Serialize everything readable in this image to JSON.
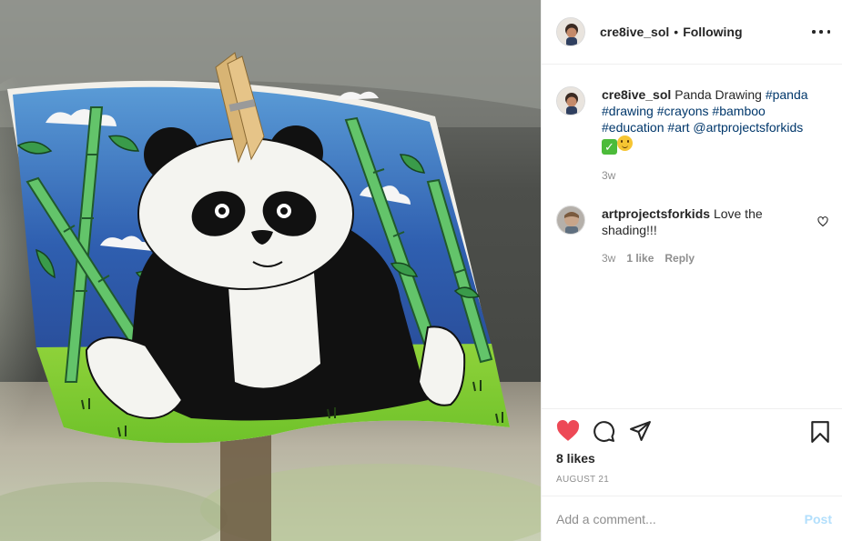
{
  "post": {
    "author": {
      "username": "cre8ive_sol",
      "separator": "•",
      "follow_status": "Following"
    },
    "caption": {
      "username": "cre8ive_sol",
      "text": "Panda Drawing",
      "hashtags": [
        "#panda",
        "#drawing",
        "#crayons",
        "#bamboo",
        "#education",
        "#art"
      ],
      "mention": "@artprojectsforkids",
      "emojis": [
        "check-mark-emoji",
        "smiling-face-emoji"
      ],
      "time": "3w"
    },
    "comments": [
      {
        "username": "artprojectsforkids",
        "text": "Love the shading!!!",
        "time": "3w",
        "likes": "1 like",
        "reply_label": "Reply"
      }
    ],
    "likes_text": "8 likes",
    "date": "AUGUST 21",
    "add_comment": {
      "placeholder": "Add a comment...",
      "post_label": "Post"
    },
    "icons": {
      "like": "heart-filled-icon",
      "comment": "comment-icon",
      "share": "paper-plane-icon",
      "save": "bookmark-icon",
      "more": "more-options-icon",
      "comment_like": "heart-outline-icon"
    },
    "colors": {
      "like_red": "#ed4956",
      "link_blue": "#00376b",
      "post_disabled": "#b2dffc",
      "meta_gray": "#8e8e8e"
    }
  }
}
